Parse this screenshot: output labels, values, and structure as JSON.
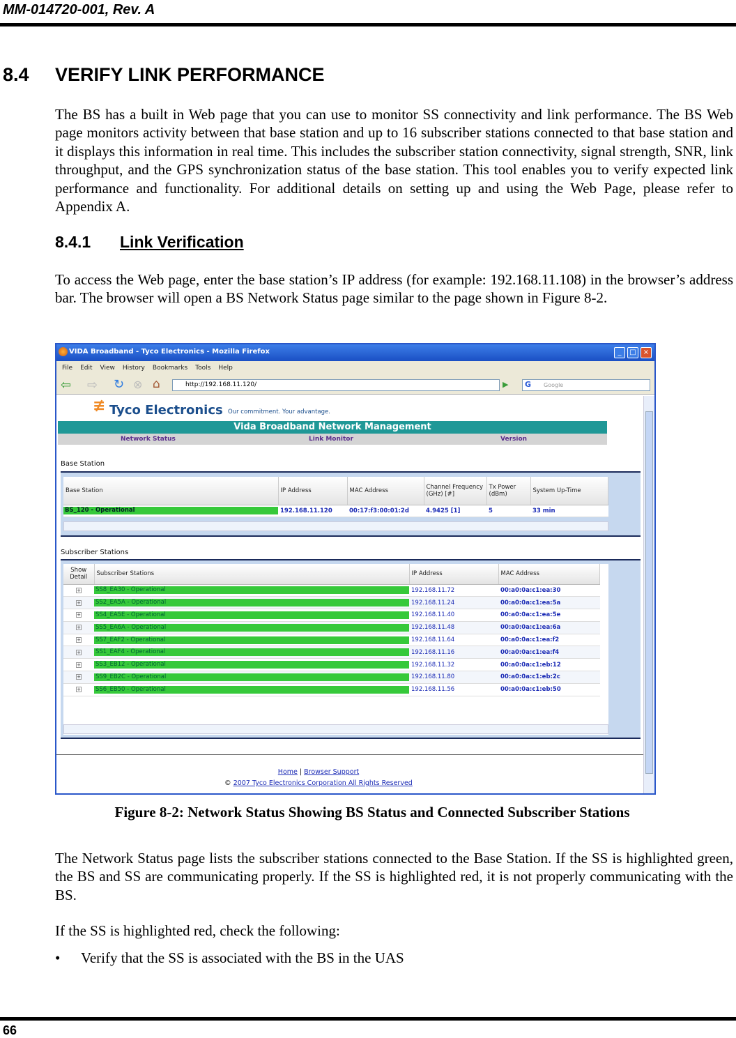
{
  "page_header": "MM-014720-001, Rev. A",
  "section": {
    "number": "8.4",
    "title": "VERIFY LINK PERFORMANCE"
  },
  "intro": "The BS has a built in Web page that you can use to monitor SS connectivity and link performance.  The BS Web page monitors activity between that base station and up to 16 subscriber stations connected to that base station and it displays this information in real time.  This includes the subscriber station connectivity, signal strength, SNR, link throughput, and the GPS synchronization status of the base station.  This tool enables you to verify expected link performance and functionality.  For additional details on setting up and using the Web Page, please refer to Appendix A.",
  "subsection": {
    "number": "8.4.1",
    "title": "Link Verification"
  },
  "access_text": "To access the Web page, enter the base station’s IP address (for example: 192.168.11.108) in the browser’s address bar.  The browser will open a BS Network Status page similar to the page shown in Figure 8-2.",
  "browser": {
    "title": "VIDA Broadband - Tyco Electronics - Mozilla Firefox",
    "menu": [
      "File",
      "Edit",
      "View",
      "History",
      "Bookmarks",
      "Tools",
      "Help"
    ],
    "url": "http://192.168.11.120/",
    "search_placeholder": "Google",
    "logo": "Tyco Electronics",
    "tagline": "Our commitment. Your advantage.",
    "banner": "Vida Broadband Network Management",
    "nav": [
      "Network Status",
      "Link Monitor",
      "Version"
    ],
    "bs_section": "Base Station",
    "bs_headers": [
      "Base Station",
      "IP Address",
      "MAC Address",
      "Channel Frequency (GHz) [#]",
      "Tx Power (dBm)",
      "System Up-Time"
    ],
    "bs_row": [
      "BS_120 - Operational",
      "192.168.11.120",
      "00:17:f3:00:01:2d",
      "4.9425 [1]",
      "5",
      "33 min"
    ],
    "ss_section": "Subscriber Stations",
    "ss_headers": [
      "Show Detail",
      "Subscriber Stations",
      "IP Address",
      "MAC Address"
    ],
    "ss_rows": [
      [
        "SS8_EA30 - Operational",
        "192.168.11.72",
        "00:a0:0a:c1:ea:30"
      ],
      [
        "SS2_EA5A - Operational",
        "192.168.11.24",
        "00:a0:0a:c1:ea:5a"
      ],
      [
        "SS4_EA5E - Operational",
        "192.168.11.40",
        "00:a0:0a:c1:ea:5e"
      ],
      [
        "SS5_EA6A - Operational",
        "192.168.11.48",
        "00:a0:0a:c1:ea:6a"
      ],
      [
        "SS7_EAF2 - Operational",
        "192.168.11.64",
        "00:a0:0a:c1:ea:f2"
      ],
      [
        "SS1_EAF4 - Operational",
        "192.168.11.16",
        "00:a0:0a:c1:ea:f4"
      ],
      [
        "SS3_EB12 - Operational",
        "192.168.11.32",
        "00:a0:0a:c1:eb:12"
      ],
      [
        "SS9_EB2C - Operational",
        "192.168.11.80",
        "00:a0:0a:c1:eb:2c"
      ],
      [
        "SS6_EB50 - Operational",
        "192.168.11.56",
        "00:a0:0a:c1:eb:50"
      ]
    ],
    "footer_home": "Home",
    "footer_sep": "|",
    "footer_support": "Browser Support",
    "copyright_symbol": "©",
    "copyright": "2007 Tyco Electronics Corporation All Rights Reserved",
    "status_color": "#36c93a"
  },
  "caption": "Figure 8-2:  Network Status Showing BS Status and Connected Subscriber Stations",
  "status_text": "The Network Status page lists the subscriber stations connected to the Base Station.  If the SS is highlighted green, the BS and SS are communicating properly.  If the SS is highlighted red, it is not properly communicating with the BS.",
  "check_text": "If the SS is highlighted red, check the following:",
  "bullets": [
    "Verify that the SS is associated with the BS in the UAS"
  ],
  "page_number": "66"
}
